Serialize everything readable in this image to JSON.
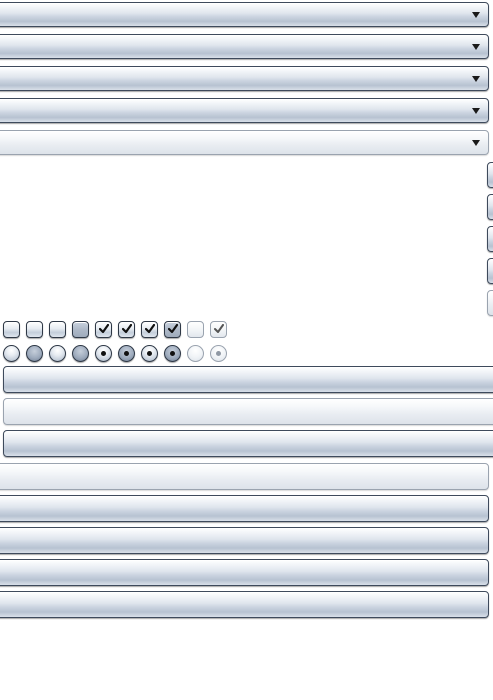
{
  "combo_boxes": [
    {
      "state": "normal",
      "arrow_icon": "chevron-down-icon"
    },
    {
      "state": "normal",
      "arrow_icon": "chevron-down-icon"
    },
    {
      "state": "normal",
      "arrow_icon": "chevron-down-icon"
    },
    {
      "state": "normal",
      "arrow_icon": "chevron-down-icon"
    },
    {
      "state": "disabled",
      "arrow_icon": "chevron-down-icon"
    }
  ],
  "side_buttons": [
    "normal",
    "normal",
    "normal",
    "normal",
    "disabled"
  ],
  "checkboxes": [
    {
      "checked": false,
      "state": "normal"
    },
    {
      "checked": false,
      "state": "hover"
    },
    {
      "checked": false,
      "state": "normal"
    },
    {
      "checked": false,
      "state": "pressed"
    },
    {
      "checked": true,
      "state": "normal"
    },
    {
      "checked": true,
      "state": "hover"
    },
    {
      "checked": true,
      "state": "normal"
    },
    {
      "checked": true,
      "state": "pressed"
    },
    {
      "checked": false,
      "state": "disabled"
    },
    {
      "checked": true,
      "state": "disabled"
    }
  ],
  "radios": [
    {
      "selected": false,
      "state": "normal"
    },
    {
      "selected": false,
      "state": "hover"
    },
    {
      "selected": false,
      "state": "normal"
    },
    {
      "selected": false,
      "state": "pressed"
    },
    {
      "selected": true,
      "state": "normal"
    },
    {
      "selected": true,
      "state": "hover"
    },
    {
      "selected": true,
      "state": "normal"
    },
    {
      "selected": true,
      "state": "pressed"
    },
    {
      "selected": false,
      "state": "disabled"
    },
    {
      "selected": true,
      "state": "disabled"
    }
  ],
  "wide_buttons": [
    "normal",
    "disabled",
    "normal"
  ],
  "full_buttons": [
    "disabled",
    "normal",
    "normal",
    "normal",
    "normal"
  ],
  "colors": {
    "border": "#3e4a5c",
    "border_disabled": "#9aa3af",
    "check_mark": "#111111",
    "background": "#ffffff"
  }
}
